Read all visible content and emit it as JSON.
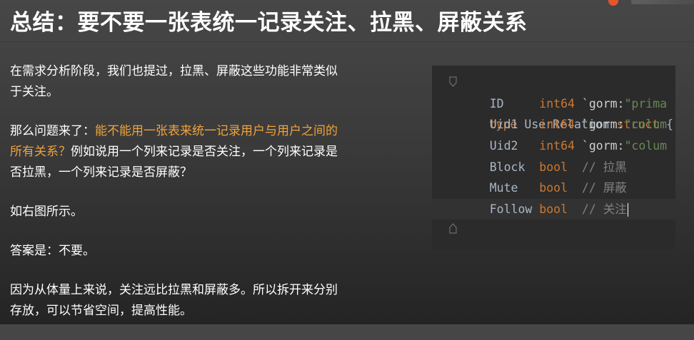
{
  "slide": {
    "title": "总结：要不要一张表统一记录关注、拉黑、屏蔽关系"
  },
  "body": {
    "p1": "在需求分析阶段，我们也提过，拉黑、屏蔽这些功能非常类似于关注。",
    "p2_lead": "那么问题来了：",
    "p2_highlight": "能不能用一张表来统一记录用户与用户之间的所有关系？",
    "p2_tail": "例如说用一个列来记录是否关注，一个列来记录是否拉黑，一个列来记录是否屏蔽？",
    "p3": "如右图所示。",
    "p4": "答案是：不要。",
    "p5": "因为从体量上来说，关注远比拉黑和屏蔽多。所以拆开来分别存放，可以节省空间，提高性能。"
  },
  "code": {
    "line0": {
      "kw": "type",
      "name": " UserRelation ",
      "kw2": "struct",
      "rest": " {  n"
    },
    "line1": {
      "field": "    ID     ",
      "type": "int64",
      "tag": " `gorm:",
      "str": "\"prima"
    },
    "line2": {
      "field": "    Uid1   ",
      "type": "int64",
      "tag": " `gorm:",
      "str": "\"colum"
    },
    "line3": {
      "field": "    Uid2   ",
      "type": "int64",
      "tag": " `gorm:",
      "str": "\"colum"
    },
    "line4": {
      "field": "    Block  ",
      "type": "bool",
      "comment": "  // 拉黑"
    },
    "line5": {
      "field": "    Mute   ",
      "type": "bool",
      "comment": "  // 屏蔽"
    },
    "line6": {
      "field": "    Follow ",
      "type": "bool",
      "comment": "  // 关注"
    },
    "line7": {
      "text": "}"
    }
  },
  "colors": {
    "highlight": "#f0a23b",
    "keyword": "#cc7832",
    "string": "#6a8759",
    "comment": "#808080",
    "editor_bg": "#2b2b2b"
  }
}
